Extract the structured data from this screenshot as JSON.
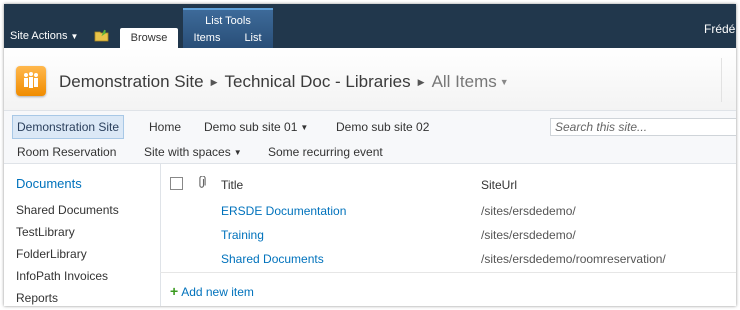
{
  "ribbon": {
    "site_actions_label": "Site Actions",
    "contextual_group": "List Tools",
    "tabs": [
      {
        "label": "Browse"
      },
      {
        "label": "Items"
      },
      {
        "label": "List"
      }
    ],
    "user_name": "Frédé"
  },
  "title_area": {
    "breadcrumbs": [
      "Demonstration Site",
      "Technical Doc - Libraries",
      "All Items"
    ]
  },
  "top_nav": {
    "row1": [
      {
        "label": "Demonstration Site",
        "selected": true
      },
      {
        "label": "Home"
      },
      {
        "label": "Demo sub site 01",
        "dropdown": true
      },
      {
        "label": "Demo sub site 02"
      }
    ],
    "row2": [
      {
        "label": "Room Reservation"
      },
      {
        "label": "Site with spaces",
        "dropdown": true
      },
      {
        "label": "Some recurring event"
      }
    ],
    "search_placeholder": "Search this site..."
  },
  "left_nav": {
    "heading": "Documents",
    "items": [
      "Shared Documents",
      "TestLibrary",
      "FolderLibrary",
      "InfoPath Invoices",
      "Reports"
    ]
  },
  "list": {
    "columns": {
      "title": "Title",
      "site_url": "SiteUrl"
    },
    "rows": [
      {
        "title": "ERSDE Documentation",
        "site_url": "/sites/ersdedemo/"
      },
      {
        "title": "Training",
        "site_url": "/sites/ersdedemo/"
      },
      {
        "title": "Shared Documents",
        "site_url": "/sites/ersdedemo/roomreservation/"
      }
    ],
    "add_new_label": "Add new item"
  },
  "icons": {
    "navigate_up": "folder-up-icon",
    "site_logo": "site-logo-icon",
    "attachment": "paperclip-icon",
    "add": "plus-icon"
  }
}
